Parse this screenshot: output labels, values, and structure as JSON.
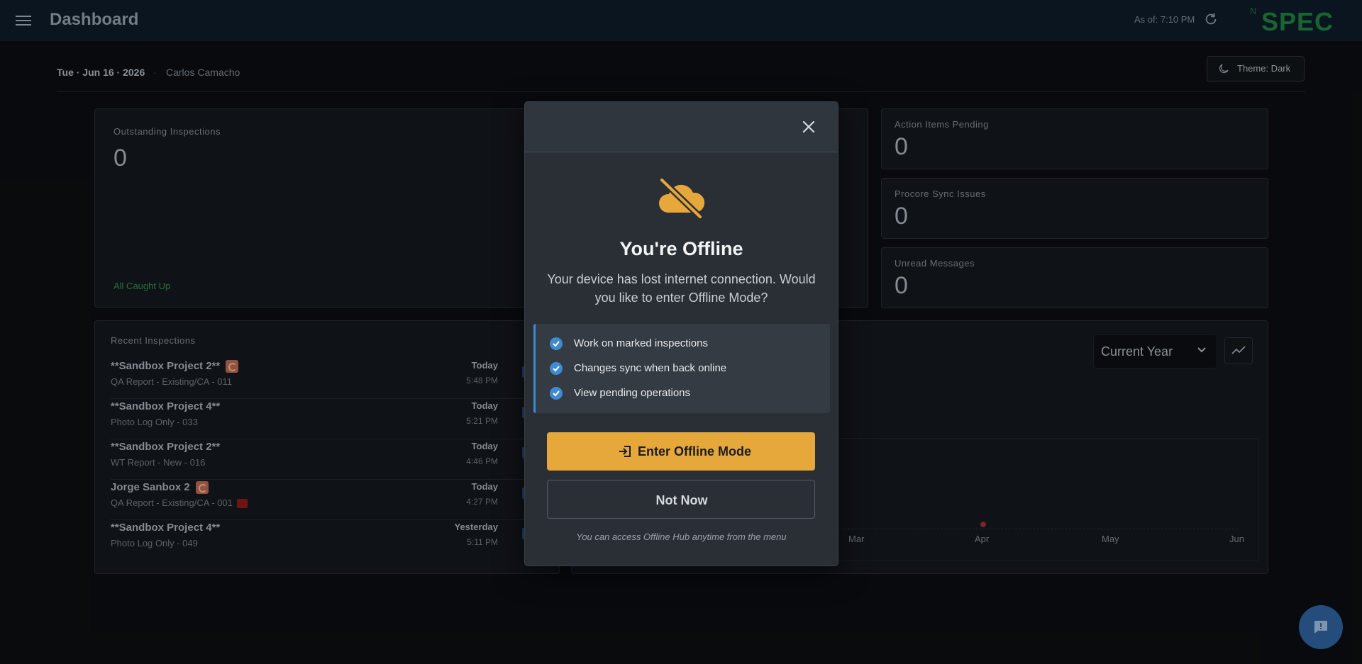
{
  "header": {
    "title": "Dashboard",
    "as_of": "As of: 7:10 PM",
    "brand_prefix": "N",
    "brand_name": "SPEC"
  },
  "subheader": {
    "date": "Tue · Jun 16 · 2026",
    "separator": "·",
    "user": "Carlos Camacho",
    "theme_label": "Theme: Dark"
  },
  "stats": {
    "outstanding": {
      "label": "Outstanding Inspections",
      "value": "0",
      "status": "All Caught Up"
    },
    "action_items": {
      "label": "Action Items Pending",
      "value": "0"
    },
    "procore": {
      "label": "Procore Sync Issues",
      "value": "0"
    },
    "unread": {
      "label": "Unread Messages",
      "value": "0"
    }
  },
  "recent": {
    "label": "Recent Inspections",
    "rows": [
      {
        "title": "**Sandbox Project 2**",
        "sub": "QA Report - Existing/CA - 011",
        "day": "Today",
        "time": "5:48 PM"
      },
      {
        "title": "**Sandbox Project 4**",
        "sub": "Photo Log Only - 033",
        "day": "Today",
        "time": "5:21 PM"
      },
      {
        "title": "**Sandbox Project 2**",
        "sub": "WT Report - New - 016",
        "day": "Today",
        "time": "4:46 PM"
      },
      {
        "title": "Jorge Sanbox 2",
        "sub": "QA Report - Existing/CA - 001",
        "day": "Today",
        "time": "4:27 PM"
      },
      {
        "title": "**Sandbox Project 4**",
        "sub": "Photo Log Only - 049",
        "day": "Yesterday",
        "time": "5:11 PM"
      }
    ]
  },
  "chart": {
    "period_select": "Current Year",
    "x_labels": [
      "Mar",
      "Apr",
      "May",
      "Jun"
    ]
  },
  "modal": {
    "title": "You're Offline",
    "description": "Your device has lost internet connection. Would you like to enter Offline Mode?",
    "features": [
      "Work on marked inspections",
      "Changes sync when back online",
      "View pending operations"
    ],
    "primary_button": "Enter Offline Mode",
    "secondary_button": "Not Now",
    "footnote": "You can access Offline Hub anytime from the menu"
  },
  "colors": {
    "accent": "#e6a83b",
    "info": "#3f8ad0",
    "success": "#2f8a4e",
    "brand": "#1e7a3f"
  }
}
